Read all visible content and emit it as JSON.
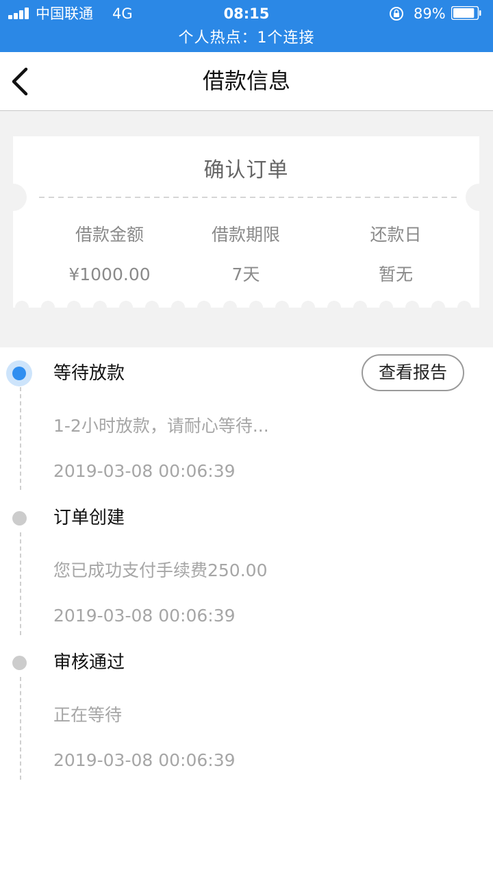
{
  "status_bar": {
    "carrier": "中国联通",
    "network": "4G",
    "time": "08:15",
    "battery_percent": "89%",
    "battery_level": 0.89,
    "hotspot_text": "个人热点：1个连接",
    "bg_color": "#2b88e6"
  },
  "nav": {
    "title": "借款信息",
    "back_icon": "chevron-left-icon"
  },
  "order_card": {
    "title": "确认订单",
    "fields": [
      {
        "label": "借款金额",
        "value": "¥1000.00"
      },
      {
        "label": "借款期限",
        "value": "7天"
      },
      {
        "label": "还款日",
        "value": "暂无"
      }
    ]
  },
  "timeline": {
    "report_button": "查看报告",
    "active_color": "#2f8ef0",
    "items": [
      {
        "title": "等待放款",
        "desc": "1-2小时放款，请耐心等待...",
        "time": "2019-03-08 00:06:39",
        "active": true
      },
      {
        "title": "订单创建",
        "desc": "您已成功支付手续费250.00",
        "time": "2019-03-08 00:06:39",
        "active": false
      },
      {
        "title": "审核通过",
        "desc": "正在等待",
        "time": "2019-03-08 00:06:39",
        "active": false
      }
    ]
  }
}
